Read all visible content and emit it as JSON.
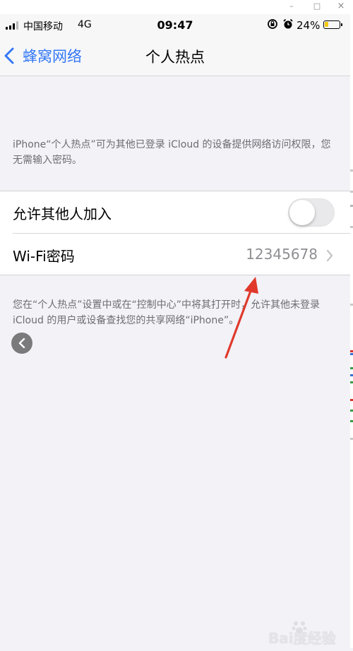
{
  "status_bar": {
    "carrier": "中国移动",
    "network": "4G",
    "time": "09:47",
    "battery": "24%"
  },
  "nav": {
    "back_label": "蜂窝网络",
    "title": "个人热点"
  },
  "description_top": "iPhone“个人热点”可为其他已登录 iCloud 的设备提供网络访问权限，您无需输入密码。",
  "settings": {
    "allow_others_label": "允许其他人加入",
    "allow_others_on": false,
    "wifi_password_label": "Wi-Fi密码",
    "wifi_password_value": "12345678"
  },
  "description_bottom": "您在“个人热点”设置中或在“控制中心”中将其打开时，允许其他未登录 iCloud 的用户或设备查找您的共享网络“iPhone”。",
  "watermark": "Bai度经验",
  "colors": {
    "accent": "#3478f6",
    "battery": "#f3c90c",
    "arrow": "#e0392b"
  }
}
